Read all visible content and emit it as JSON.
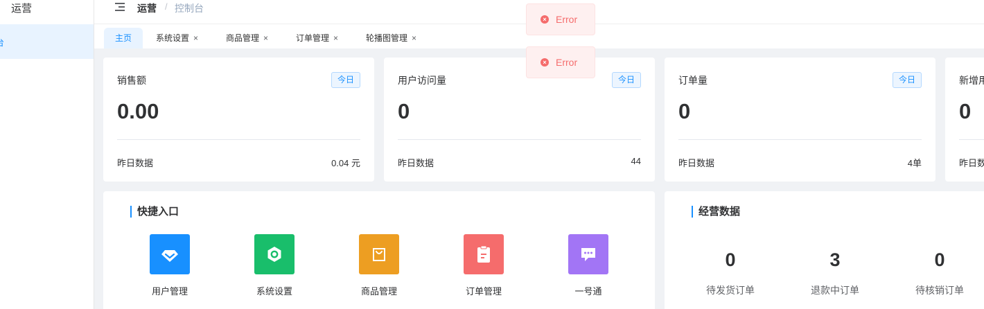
{
  "sidebar": {
    "title": "运营",
    "active_item": "台"
  },
  "header": {
    "breadcrumb": [
      "运营",
      "控制台"
    ],
    "separator": "/"
  },
  "tabs": [
    {
      "label": "主页",
      "closable": false
    },
    {
      "label": "系统设置",
      "closable": true
    },
    {
      "label": "商品管理",
      "closable": true
    },
    {
      "label": "订单管理",
      "closable": true
    },
    {
      "label": "轮播图管理",
      "closable": true
    }
  ],
  "tab_close_glyph": "×",
  "toasts": [
    "Error",
    "Error"
  ],
  "stats": [
    {
      "label": "销售额",
      "badge": "今日",
      "value": "0.00",
      "foot_label": "昨日数据",
      "foot_value": "0.04 元"
    },
    {
      "label": "用户访问量",
      "badge": "今日",
      "value": "0",
      "foot_label": "昨日数据",
      "foot_value": "44"
    },
    {
      "label": "订单量",
      "badge": "今日",
      "value": "0",
      "foot_label": "昨日数据",
      "foot_value": "4单"
    },
    {
      "label": "新增用",
      "value": "0",
      "foot_label": "昨日数"
    }
  ],
  "quick_access": {
    "title": "快捷入口",
    "items": [
      {
        "label": "用户管理",
        "icon": "user-diamond-icon",
        "color": "#1890ff"
      },
      {
        "label": "系统设置",
        "icon": "settings-hex-icon",
        "color": "#19be6b"
      },
      {
        "label": "商品管理",
        "icon": "shopping-bag-icon",
        "color": "#ed9e22"
      },
      {
        "label": "订单管理",
        "icon": "clipboard-icon",
        "color": "#f56c6c"
      },
      {
        "label": "一号通",
        "icon": "chat-bubble-icon",
        "color": "#a275f5"
      }
    ]
  },
  "business": {
    "title": "经营数据",
    "items": [
      {
        "value": "0",
        "label": "待发货订单"
      },
      {
        "value": "3",
        "label": "退款中订单"
      },
      {
        "value": "0",
        "label": "待核销订单"
      }
    ]
  }
}
